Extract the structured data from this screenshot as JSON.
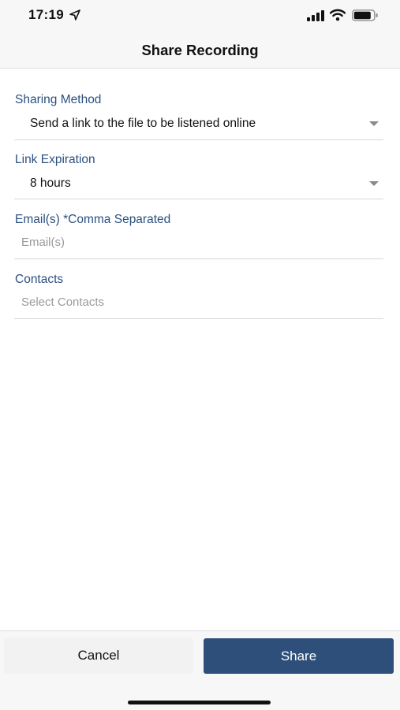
{
  "status_bar": {
    "time": "17:19",
    "icons": [
      "location-arrow-icon",
      "cellular-signal-icon",
      "wifi-icon",
      "battery-icon"
    ]
  },
  "nav": {
    "title": "Share Recording"
  },
  "form": {
    "sharing_method": {
      "label": "Sharing Method",
      "value": "Send a link to the file to be listened online"
    },
    "link_expiration": {
      "label": "Link Expiration",
      "value": "8 hours"
    },
    "emails": {
      "label": "Email(s) *Comma Separated",
      "placeholder": "Email(s)"
    },
    "contacts": {
      "label": "Contacts",
      "placeholder": "Select Contacts"
    }
  },
  "actions": {
    "cancel_label": "Cancel",
    "share_label": "Share"
  },
  "colors": {
    "label_blue": "#2b5080",
    "primary_button": "#2d4f7a",
    "placeholder_gray": "#9a9a9a"
  }
}
